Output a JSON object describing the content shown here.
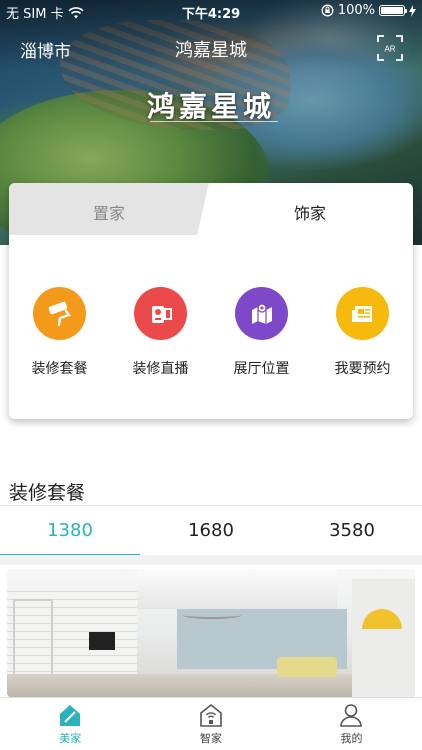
{
  "status_bar": {
    "carrier": "无 SIM 卡",
    "time": "下午4:29",
    "battery": "100%",
    "battery_level": 1.0
  },
  "header": {
    "city": "淄博市",
    "project_title": "鸿嘉星城",
    "ar_label": "AR",
    "banner_logo_text": "鸿嘉星城"
  },
  "card": {
    "tabs": [
      {
        "label": "置家",
        "active": false
      },
      {
        "label": "饰家",
        "active": true
      }
    ],
    "features": [
      {
        "label": "装修套餐",
        "icon": "paint-roller-icon",
        "color": "#f39a1a"
      },
      {
        "label": "装修直播",
        "icon": "video-camera-icon",
        "color": "#ea4a4a"
      },
      {
        "label": "展厅位置",
        "icon": "map-location-icon",
        "color": "#7d49c8"
      },
      {
        "label": "我要预约",
        "icon": "reservation-note-icon",
        "color": "#f6b90e"
      }
    ]
  },
  "packages": {
    "section_title": "装修套餐",
    "tabs": [
      "1380",
      "1680",
      "3580"
    ],
    "active_index": 0
  },
  "bottom_nav": [
    {
      "label": "美家",
      "icon": "home-icon",
      "active": true
    },
    {
      "label": "智家",
      "icon": "smart-home-icon",
      "active": false
    },
    {
      "label": "我的",
      "icon": "user-icon",
      "active": false
    }
  ],
  "colors": {
    "accent": "#2bb3bd"
  }
}
